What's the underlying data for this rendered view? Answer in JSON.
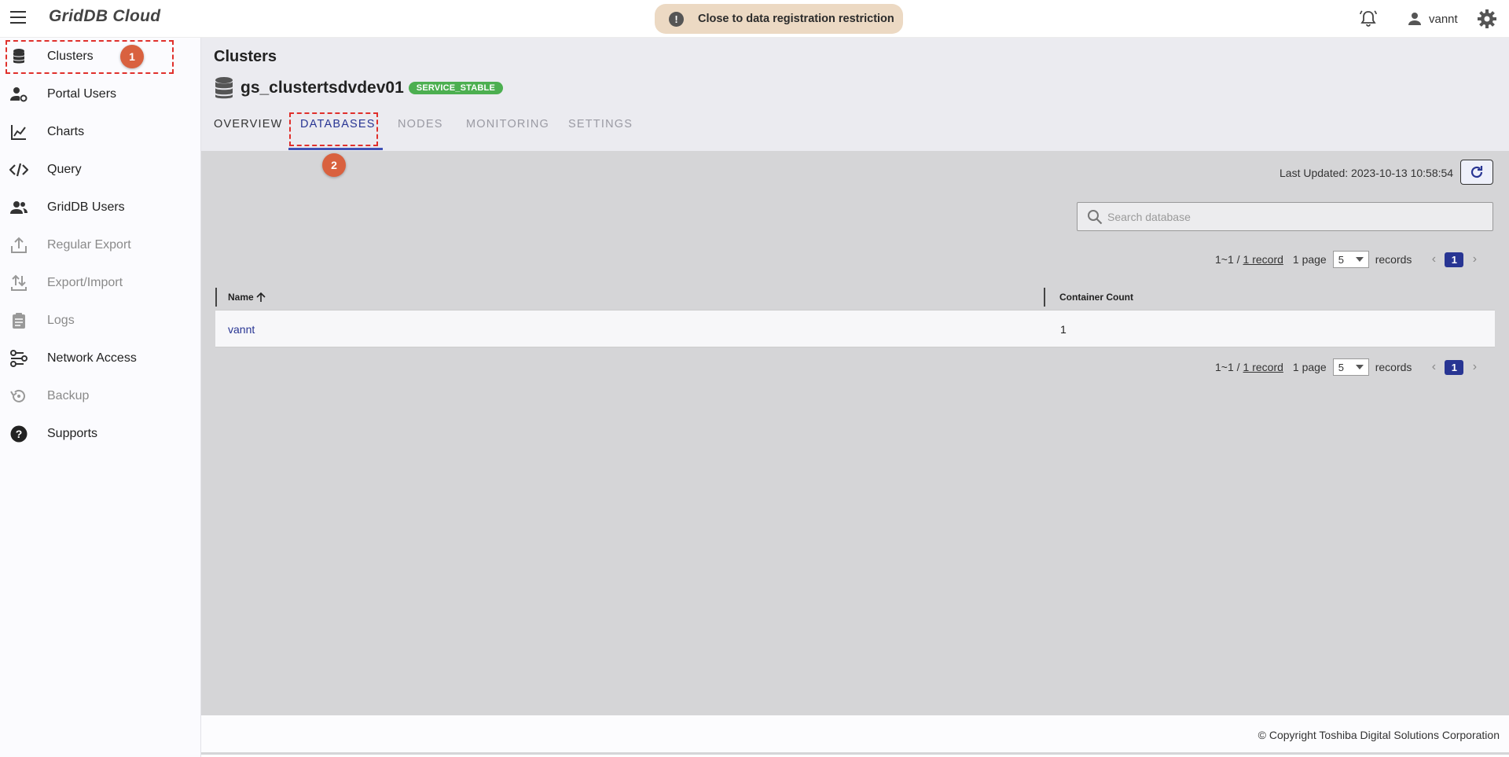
{
  "app": {
    "logo": "GridDB Cloud"
  },
  "notice": {
    "icon": "exclamation-icon",
    "text": "Close to data registration restriction"
  },
  "user": {
    "name": "vannt"
  },
  "sidebar": {
    "items": [
      {
        "label": "Clusters",
        "icon": "database-icon",
        "enabled": true
      },
      {
        "label": "Portal Users",
        "icon": "user-gear-icon",
        "enabled": true
      },
      {
        "label": "Charts",
        "icon": "line-chart-icon",
        "enabled": true
      },
      {
        "label": "Query",
        "icon": "code-icon",
        "enabled": true
      },
      {
        "label": "GridDB Users",
        "icon": "users-icon",
        "enabled": true
      },
      {
        "label": "Regular Export",
        "icon": "export-icon",
        "enabled": false
      },
      {
        "label": "Export/Import",
        "icon": "import-export-icon",
        "enabled": false
      },
      {
        "label": "Logs",
        "icon": "clipboard-icon",
        "enabled": false
      },
      {
        "label": "Network Access",
        "icon": "network-icon",
        "enabled": true
      },
      {
        "label": "Backup",
        "icon": "backup-icon",
        "enabled": false
      },
      {
        "label": "Supports",
        "icon": "help-icon",
        "enabled": true
      }
    ]
  },
  "annotations": {
    "step1": "1",
    "step2": "2"
  },
  "header": {
    "title": "Clusters",
    "cluster_name": "gs_clustertsdvdev01",
    "status": "SERVICE_STABLE",
    "tabs": [
      "OVERVIEW",
      "DATABASES",
      "NODES",
      "MONITORING",
      "SETTINGS"
    ],
    "active_tab": "DATABASES"
  },
  "content": {
    "last_updated": "Last Updated: 2023-10-13 10:58:54",
    "search_placeholder": "Search database",
    "pagination": {
      "range": "1~1 /",
      "record_link": "1 record",
      "page_text": "1 page",
      "per_page": "5",
      "records_text": "records",
      "current_page": "1"
    },
    "table": {
      "columns": [
        "Name",
        "Container Count"
      ],
      "rows": [
        {
          "name": "vannt",
          "container_count": "1"
        }
      ]
    }
  },
  "footer": {
    "copyright": "© Copyright Toshiba Digital Solutions Corporation"
  },
  "colors": {
    "accent": "#283593",
    "status_green": "#4caf50",
    "annotation": "#d9613f",
    "highlight": "#e0302c"
  }
}
